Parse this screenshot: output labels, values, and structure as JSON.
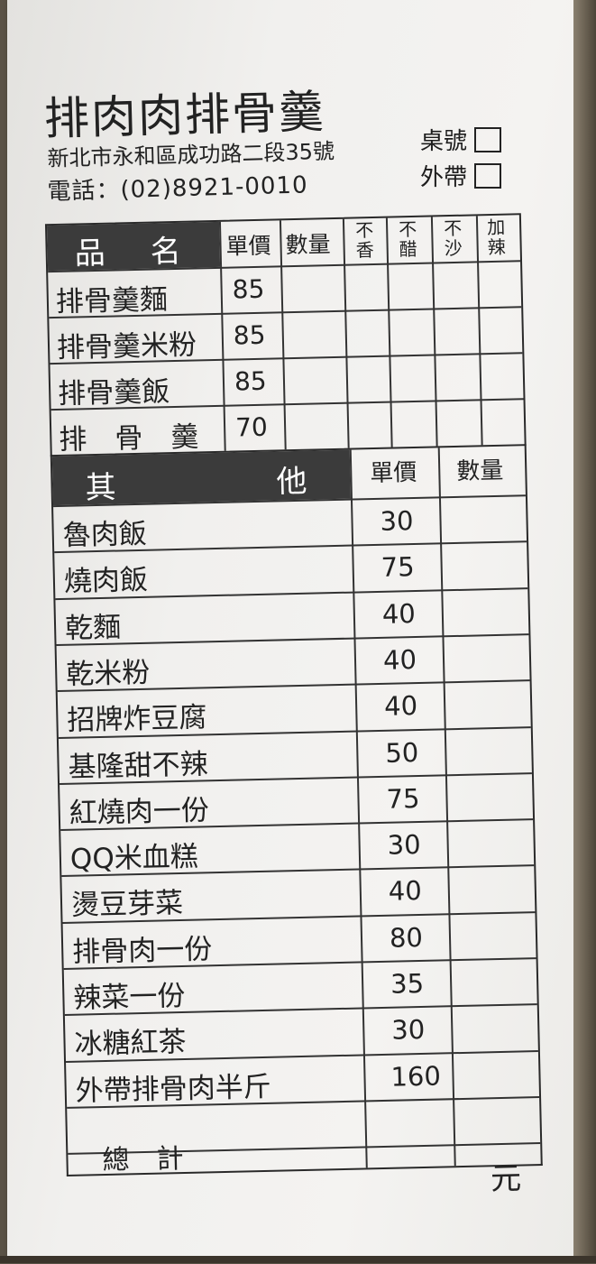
{
  "shop": {
    "name": "排肉肉排骨羹",
    "address": "新北市永和區成功路二段35號",
    "phone": "電話：(02)8921-0010"
  },
  "order_type": {
    "dine_in_label": "桌號",
    "takeout_label": "外帶"
  },
  "main_table": {
    "headers": {
      "name": "品　名",
      "price": "單價",
      "qty": "數量",
      "no_cilantro": "不香",
      "no_vinegar": "不醋",
      "no_sauce": "不沙",
      "extra_spicy": "加辣"
    },
    "rows": [
      {
        "name": "排骨羹麵",
        "price": "85"
      },
      {
        "name": "排骨羹米粉",
        "price": "85"
      },
      {
        "name": "排骨羹飯",
        "price": "85"
      },
      {
        "name": "排　骨　羹",
        "price": "70"
      }
    ]
  },
  "other_table": {
    "headers": {
      "name_left": "其",
      "name_right": "他",
      "price": "單價",
      "qty": "數量"
    },
    "rows": [
      {
        "name": "魯肉飯",
        "price": "30"
      },
      {
        "name": "燒肉飯",
        "price": "75"
      },
      {
        "name": "乾麵",
        "price": "40"
      },
      {
        "name": "乾米粉",
        "price": "40"
      },
      {
        "name": "招牌炸豆腐",
        "price": "40"
      },
      {
        "name": "基隆甜不辣",
        "price": "50"
      },
      {
        "name": "紅燒肉一份",
        "price": "75"
      },
      {
        "name": "QQ米血糕",
        "price": "30"
      },
      {
        "name": "燙豆芽菜",
        "price": "40"
      },
      {
        "name": "排骨肉一份",
        "price": "80"
      },
      {
        "name": "辣菜一份",
        "price": "35"
      },
      {
        "name": "冰糖紅茶",
        "price": "30"
      },
      {
        "name": "外帶排骨肉半斤",
        "price": "160"
      }
    ]
  },
  "total": {
    "label": "總　計",
    "unit": "元"
  },
  "colors": {
    "header_bg": "#3b3b3b",
    "paper": "#f2f1ef",
    "ink": "#222222"
  }
}
